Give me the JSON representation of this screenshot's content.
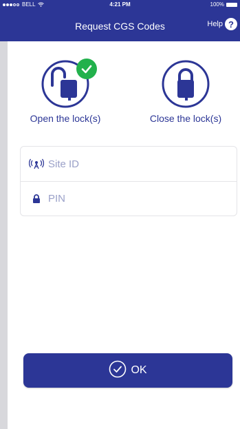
{
  "status_bar": {
    "carrier": "BELL",
    "time": "4:21 PM",
    "battery": "100%"
  },
  "nav": {
    "title": "Request CGS Codes",
    "help_label": "Help",
    "help_icon": "?"
  },
  "lock_options": {
    "open": {
      "label": "Open the lock(s)",
      "selected": true
    },
    "close": {
      "label": "Close the lock(s)",
      "selected": false
    }
  },
  "form": {
    "site_id": {
      "placeholder": "Site ID",
      "value": ""
    },
    "pin": {
      "placeholder": "PIN",
      "value": ""
    }
  },
  "ok_button": {
    "label": "OK"
  },
  "colors": {
    "brand": "#2c3696",
    "check": "#22b14c",
    "placeholder": "#9aa0c8"
  },
  "icons": {
    "open_lock": "unlocked-padlock-icon",
    "close_lock": "locked-padlock-icon",
    "check": "checkmark-icon",
    "site": "antenna-icon",
    "pin": "lock-icon",
    "ok": "check-circle-icon"
  }
}
